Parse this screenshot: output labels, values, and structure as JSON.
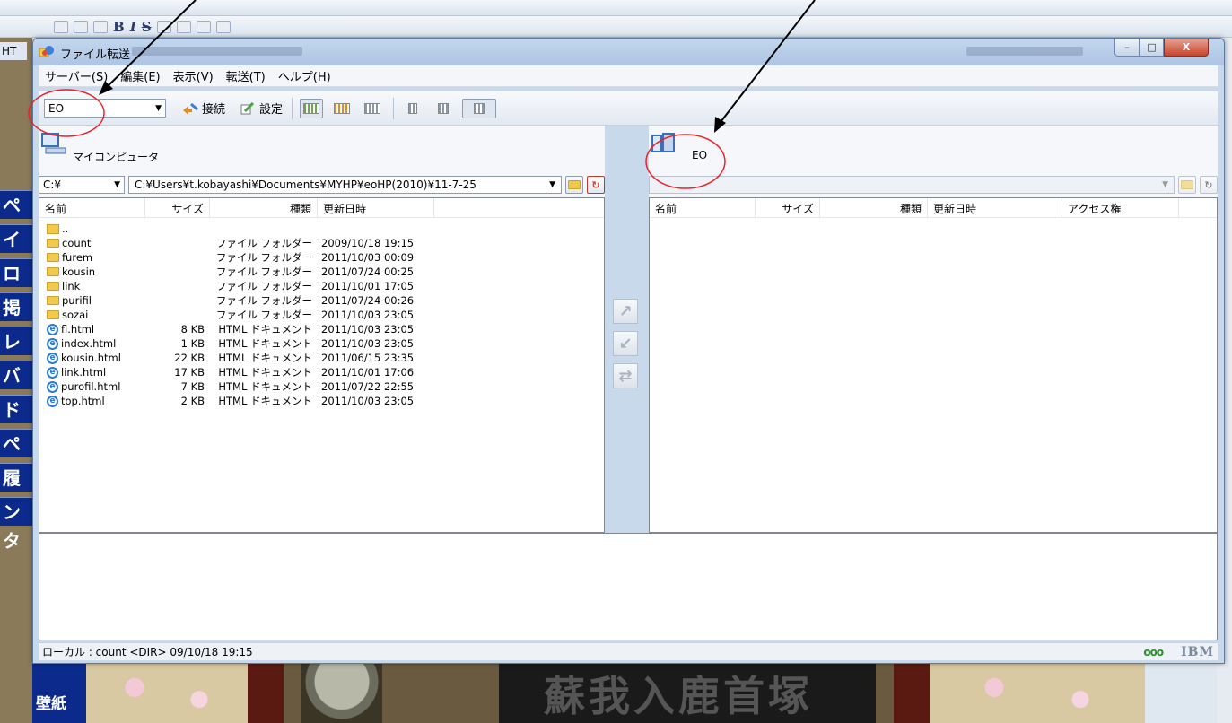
{
  "window": {
    "title": "ファイル転送",
    "minimize": "–",
    "maximize": "□",
    "close": "X"
  },
  "menu": [
    "サーバー(S)",
    "編集(E)",
    "表示(V)",
    "転送(T)",
    "ヘルプ(H)"
  ],
  "toolbar": {
    "profile": "EO",
    "connect_label": "接続",
    "settings_label": "設定"
  },
  "left": {
    "caption": "マイコンピュータ",
    "drive": "C:¥",
    "path": "C:¥Users¥t.kobayashi¥Documents¥MYHP¥eoHP(2010)¥11-7-25",
    "columns": [
      "名前",
      "サイズ",
      "種類",
      "更新日時"
    ],
    "parent_entry": "..",
    "rows": [
      {
        "name": "count",
        "size": "",
        "type": "ファイル フォルダー",
        "date": "2009/10/18 19:15",
        "kind": "folder"
      },
      {
        "name": "furem",
        "size": "",
        "type": "ファイル フォルダー",
        "date": "2011/10/03 00:09",
        "kind": "folder"
      },
      {
        "name": "kousin",
        "size": "",
        "type": "ファイル フォルダー",
        "date": "2011/07/24 00:25",
        "kind": "folder"
      },
      {
        "name": "link",
        "size": "",
        "type": "ファイル フォルダー",
        "date": "2011/10/01 17:05",
        "kind": "folder"
      },
      {
        "name": "purifil",
        "size": "",
        "type": "ファイル フォルダー",
        "date": "2011/07/24 00:26",
        "kind": "folder"
      },
      {
        "name": "sozai",
        "size": "",
        "type": "ファイル フォルダー",
        "date": "2011/10/03 23:05",
        "kind": "folder"
      },
      {
        "name": "fl.html",
        "size": "8 KB",
        "type": "HTML ドキュメント",
        "date": "2011/10/03 23:05",
        "kind": "html"
      },
      {
        "name": "index.html",
        "size": "1 KB",
        "type": "HTML ドキュメント",
        "date": "2011/10/03 23:05",
        "kind": "html"
      },
      {
        "name": "kousin.html",
        "size": "22 KB",
        "type": "HTML ドキュメント",
        "date": "2011/06/15 23:35",
        "kind": "html"
      },
      {
        "name": "link.html",
        "size": "17 KB",
        "type": "HTML ドキュメント",
        "date": "2011/10/01 17:06",
        "kind": "html"
      },
      {
        "name": "purofil.html",
        "size": "7 KB",
        "type": "HTML ドキュメント",
        "date": "2011/07/22 22:55",
        "kind": "html"
      },
      {
        "name": "top.html",
        "size": "2 KB",
        "type": "HTML ドキュメント",
        "date": "2011/10/03 23:05",
        "kind": "html"
      }
    ]
  },
  "right": {
    "caption": "EO",
    "path": "",
    "columns": [
      "名前",
      "サイズ",
      "種類",
      "更新日時",
      "アクセス権"
    ]
  },
  "status": {
    "text": "ローカル : count <DIR> 09/10/18 19:15",
    "dots": "ooo",
    "brand": "IBM"
  },
  "background": {
    "tab_label": "HT",
    "side_labels": [
      "ペ",
      "イー",
      "ロク",
      "掲示",
      "レバ",
      "バム",
      "ドシ",
      "ペー",
      "履歴",
      "ンタ"
    ],
    "wallpaper_label": "壁紙",
    "sign_text": "蘇我入鹿首塚"
  },
  "colors": {
    "annotation": "#e8232a",
    "title_bar": "#b7cce8",
    "selection_border": "#8c9cb2"
  }
}
